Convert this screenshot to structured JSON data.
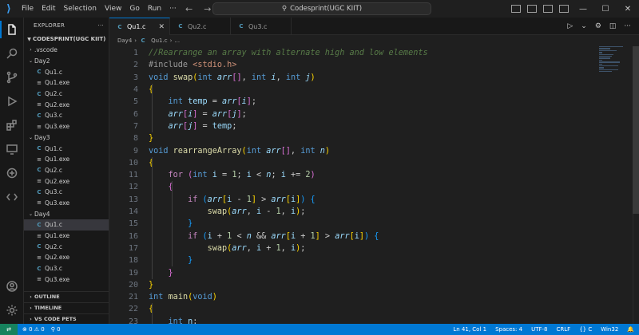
{
  "menu": [
    "File",
    "Edit",
    "Selection",
    "View",
    "Go",
    "Run",
    "···"
  ],
  "command_center": "Codesprint(UGC KIIT)",
  "sidebar": {
    "header": "EXPLORER",
    "folder": "CODESPRINT(UGC KIIT)",
    "tree": [
      {
        "label": ".vscode",
        "kind": "folder",
        "open": false,
        "depth": 1
      },
      {
        "label": "Day2",
        "kind": "folder",
        "open": true,
        "depth": 1
      },
      {
        "label": "Qu1.c",
        "kind": "c",
        "depth": 2
      },
      {
        "label": "Qu1.exe",
        "kind": "exe",
        "depth": 2
      },
      {
        "label": "Qu2.c",
        "kind": "c",
        "depth": 2
      },
      {
        "label": "Qu2.exe",
        "kind": "exe",
        "depth": 2
      },
      {
        "label": "Qu3.c",
        "kind": "c",
        "depth": 2
      },
      {
        "label": "Qu3.exe",
        "kind": "exe",
        "depth": 2
      },
      {
        "label": "Day3",
        "kind": "folder",
        "open": true,
        "depth": 1
      },
      {
        "label": "Qu1.c",
        "kind": "c",
        "depth": 2
      },
      {
        "label": "Qu1.exe",
        "kind": "exe",
        "depth": 2
      },
      {
        "label": "Qu2.c",
        "kind": "c",
        "depth": 2
      },
      {
        "label": "Qu2.exe",
        "kind": "exe",
        "depth": 2
      },
      {
        "label": "Qu3.c",
        "kind": "c",
        "depth": 2
      },
      {
        "label": "Qu3.exe",
        "kind": "exe",
        "depth": 2
      },
      {
        "label": "Day4",
        "kind": "folder",
        "open": true,
        "depth": 1
      },
      {
        "label": "Qu1.c",
        "kind": "c",
        "depth": 2,
        "selected": true
      },
      {
        "label": "Qu1.exe",
        "kind": "exe",
        "depth": 2
      },
      {
        "label": "Qu2.c",
        "kind": "c",
        "depth": 2
      },
      {
        "label": "Qu2.exe",
        "kind": "exe",
        "depth": 2
      },
      {
        "label": "Qu3.c",
        "kind": "c",
        "depth": 2
      },
      {
        "label": "Qu3.exe",
        "kind": "exe",
        "depth": 2
      }
    ],
    "sections": [
      "OUTLINE",
      "TIMELINE",
      "VS CODE PETS"
    ]
  },
  "tabs": [
    {
      "label": "Qu1.c",
      "active": true
    },
    {
      "label": "Qu2.c",
      "active": false
    },
    {
      "label": "Qu3.c",
      "active": false
    }
  ],
  "breadcrumb": [
    "Day4",
    "Qu1.c",
    "..."
  ],
  "editor": {
    "current_line": 41,
    "lines": [
      [
        [
          "t-cm",
          "//Rearrange an array with alternate high and low elements"
        ]
      ],
      [
        [
          "t-pp",
          "#include "
        ],
        [
          "t-inc",
          "<stdio.h>"
        ]
      ],
      [
        [
          "t-kw",
          "void "
        ],
        [
          "t-fn",
          "swap"
        ],
        [
          "b1",
          "("
        ],
        [
          "t-kw",
          "int "
        ],
        [
          "t-prm",
          "arr"
        ],
        [
          "b2",
          "[]"
        ],
        [
          "",
          ", "
        ],
        [
          "t-kw",
          "int "
        ],
        [
          "t-prm",
          "i"
        ],
        [
          "",
          ", "
        ],
        [
          "t-kw",
          "int "
        ],
        [
          "t-prm",
          "j"
        ],
        [
          "b1",
          ")"
        ]
      ],
      [
        [
          "b1",
          "{"
        ]
      ],
      [
        [
          "",
          "    "
        ],
        [
          "t-kw",
          "int "
        ],
        [
          "t-var",
          "temp"
        ],
        [
          "",
          " = "
        ],
        [
          "t-prm",
          "arr"
        ],
        [
          "b2",
          "["
        ],
        [
          "t-prm",
          "i"
        ],
        [
          "b2",
          "]"
        ],
        [
          "",
          ";"
        ]
      ],
      [
        [
          "",
          "    "
        ],
        [
          "t-prm",
          "arr"
        ],
        [
          "b2",
          "["
        ],
        [
          "t-prm",
          "i"
        ],
        [
          "b2",
          "]"
        ],
        [
          "",
          " = "
        ],
        [
          "t-prm",
          "arr"
        ],
        [
          "b2",
          "["
        ],
        [
          "t-prm",
          "j"
        ],
        [
          "b2",
          "]"
        ],
        [
          "",
          ";"
        ]
      ],
      [
        [
          "",
          "    "
        ],
        [
          "t-prm",
          "arr"
        ],
        [
          "b2",
          "["
        ],
        [
          "t-prm",
          "j"
        ],
        [
          "b2",
          "]"
        ],
        [
          "",
          " = "
        ],
        [
          "t-var",
          "temp"
        ],
        [
          "",
          ";"
        ]
      ],
      [
        [
          "b1",
          "}"
        ]
      ],
      [
        [
          "t-kw",
          "void "
        ],
        [
          "t-fn",
          "rearrangeArray"
        ],
        [
          "b1",
          "("
        ],
        [
          "t-kw",
          "int "
        ],
        [
          "t-prm",
          "arr"
        ],
        [
          "b2",
          "[]"
        ],
        [
          "",
          ", "
        ],
        [
          "t-kw",
          "int "
        ],
        [
          "t-prm",
          "n"
        ],
        [
          "b1",
          ")"
        ]
      ],
      [
        [
          "b1",
          "{"
        ]
      ],
      [
        [
          "",
          "    "
        ],
        [
          "t-ctl",
          "for "
        ],
        [
          "b2",
          "("
        ],
        [
          "t-kw",
          "int "
        ],
        [
          "t-var",
          "i"
        ],
        [
          "",
          " = "
        ],
        [
          "t-num",
          "1"
        ],
        [
          "",
          "; "
        ],
        [
          "t-var",
          "i"
        ],
        [
          "",
          " < "
        ],
        [
          "t-prm",
          "n"
        ],
        [
          "",
          "; "
        ],
        [
          "t-var",
          "i"
        ],
        [
          "",
          " += "
        ],
        [
          "t-num",
          "2"
        ],
        [
          "b2",
          ")"
        ]
      ],
      [
        [
          "",
          "    "
        ],
        [
          "b2",
          "{"
        ]
      ],
      [
        [
          "",
          "        "
        ],
        [
          "t-ctl",
          "if "
        ],
        [
          "b3",
          "("
        ],
        [
          "t-prm",
          "arr"
        ],
        [
          "b1",
          "["
        ],
        [
          "t-var",
          "i"
        ],
        [
          "",
          " - "
        ],
        [
          "t-num",
          "1"
        ],
        [
          "b1",
          "]"
        ],
        [
          "",
          " > "
        ],
        [
          "t-prm",
          "arr"
        ],
        [
          "b1",
          "["
        ],
        [
          "t-var",
          "i"
        ],
        [
          "b1",
          "]"
        ],
        [
          "b3",
          ")"
        ],
        [
          "",
          " "
        ],
        [
          "b3",
          "{"
        ]
      ],
      [
        [
          "",
          "            "
        ],
        [
          "t-fn",
          "swap"
        ],
        [
          "b1",
          "("
        ],
        [
          "t-prm",
          "arr"
        ],
        [
          "",
          ", "
        ],
        [
          "t-var",
          "i"
        ],
        [
          "",
          " - "
        ],
        [
          "t-num",
          "1"
        ],
        [
          "",
          ", "
        ],
        [
          "t-var",
          "i"
        ],
        [
          "b1",
          ")"
        ],
        [
          "",
          ";"
        ]
      ],
      [
        [
          "",
          "        "
        ],
        [
          "b3",
          "}"
        ]
      ],
      [
        [
          "",
          "        "
        ],
        [
          "t-ctl",
          "if "
        ],
        [
          "b3",
          "("
        ],
        [
          "t-var",
          "i"
        ],
        [
          "",
          " + "
        ],
        [
          "t-num",
          "1"
        ],
        [
          "",
          " < "
        ],
        [
          "t-prm",
          "n"
        ],
        [
          "",
          " && "
        ],
        [
          "t-prm",
          "arr"
        ],
        [
          "b1",
          "["
        ],
        [
          "t-var",
          "i"
        ],
        [
          "",
          " + "
        ],
        [
          "t-num",
          "1"
        ],
        [
          "b1",
          "]"
        ],
        [
          "",
          " > "
        ],
        [
          "t-prm",
          "arr"
        ],
        [
          "b1",
          "["
        ],
        [
          "t-var",
          "i"
        ],
        [
          "b1",
          "]"
        ],
        [
          "b3",
          ")"
        ],
        [
          "",
          " "
        ],
        [
          "b3",
          "{"
        ]
      ],
      [
        [
          "",
          "            "
        ],
        [
          "t-fn",
          "swap"
        ],
        [
          "b1",
          "("
        ],
        [
          "t-prm",
          "arr"
        ],
        [
          "",
          ", "
        ],
        [
          "t-var",
          "i"
        ],
        [
          "",
          " + "
        ],
        [
          "t-num",
          "1"
        ],
        [
          "",
          ", "
        ],
        [
          "t-var",
          "i"
        ],
        [
          "b1",
          ")"
        ],
        [
          "",
          ";"
        ]
      ],
      [
        [
          "",
          "        "
        ],
        [
          "b3",
          "}"
        ]
      ],
      [
        [
          "",
          "    "
        ],
        [
          "b2",
          "}"
        ]
      ],
      [
        [
          "b1",
          "}"
        ]
      ],
      [
        [
          "t-kw",
          "int "
        ],
        [
          "t-fn",
          "main"
        ],
        [
          "b1",
          "("
        ],
        [
          "t-kw",
          "void"
        ],
        [
          "b1",
          ")"
        ]
      ],
      [
        [
          "b1",
          "{"
        ]
      ],
      [
        [
          "",
          "    "
        ],
        [
          "t-kw",
          "int "
        ],
        [
          "t-var",
          "n"
        ],
        [
          "",
          ";"
        ]
      ]
    ]
  },
  "statusbar": {
    "remote": "⇄",
    "errors": "⊗ 0 ⚠ 0",
    "ports": "⚲ 0",
    "position": "Ln 41, Col 1",
    "spaces": "Spaces: 4",
    "encoding": "UTF-8",
    "eol": "CRLF",
    "language": "{} C",
    "platform": "Win32",
    "bell": "🔔"
  },
  "colors": {
    "accent": "#0078d4",
    "editor_bg": "#1f1f1f",
    "sidebar_bg": "#181818",
    "statusbar_bg": "#0078d4"
  }
}
